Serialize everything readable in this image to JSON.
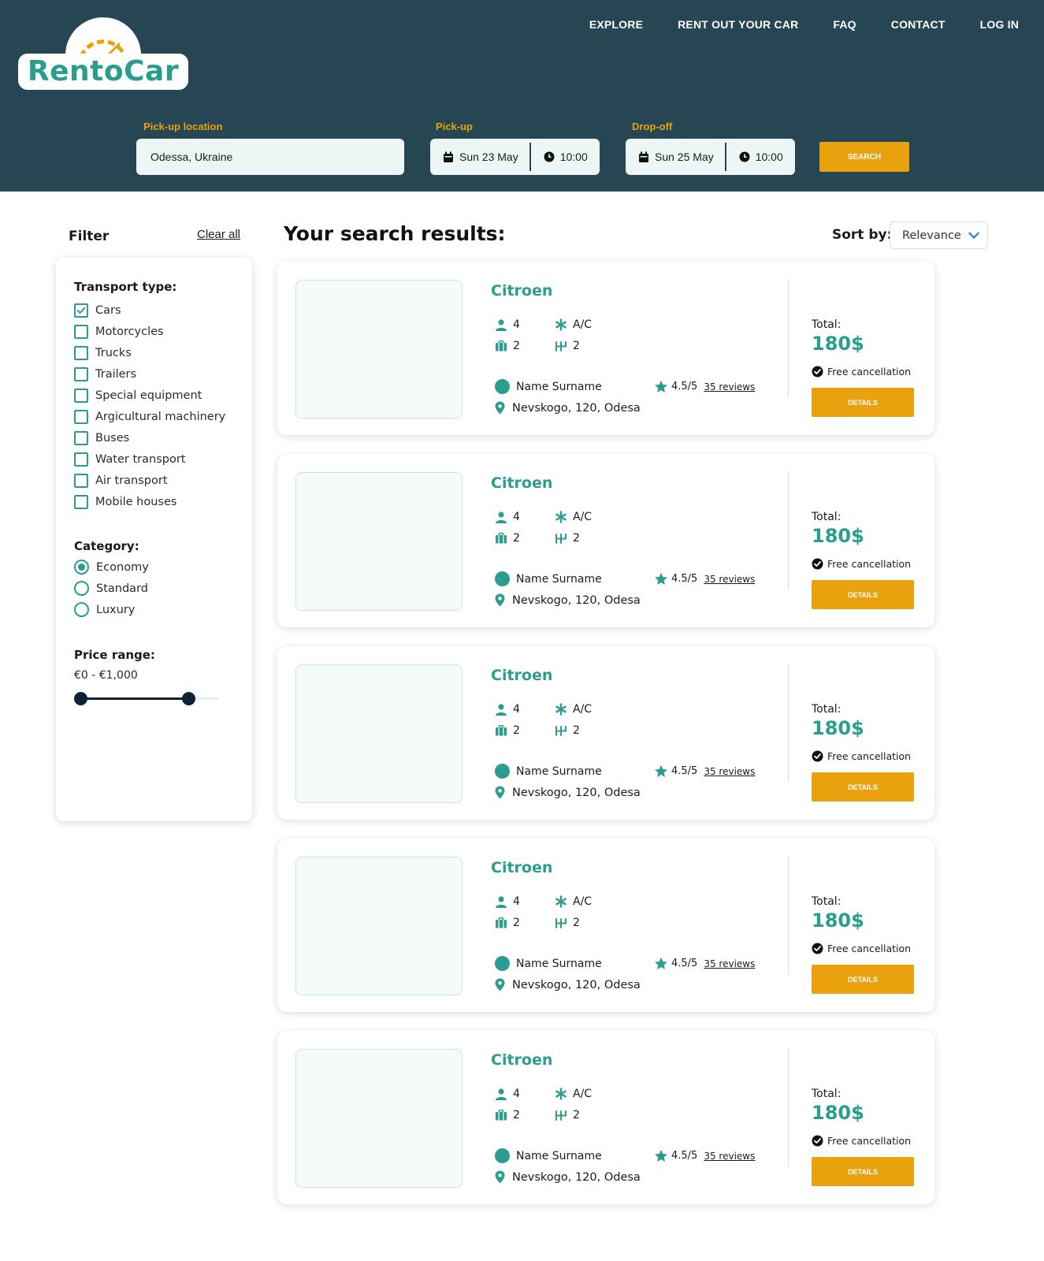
{
  "brand": {
    "name": "RentoCar"
  },
  "nav": [
    "EXPLORE",
    "RENT OUT YOUR CAR",
    "FAQ",
    "CONTACT",
    "LOG IN"
  ],
  "search": {
    "location_label": "Pick-up location",
    "location_value": "Odessa, Ukraine",
    "pickup_label": "Pick-up",
    "pickup_date": "Sun 23 May",
    "pickup_time": "10:00",
    "dropoff_label": "Drop-off",
    "dropoff_date": "Sun 25 May",
    "dropoff_time": "10:00",
    "button": "SEARCH"
  },
  "filter": {
    "title": "Filter",
    "clear": "Clear all",
    "transport_heading": "Transport type:",
    "transport_types": [
      {
        "label": "Cars",
        "checked": true
      },
      {
        "label": "Motorcycles",
        "checked": false
      },
      {
        "label": "Trucks",
        "checked": false
      },
      {
        "label": "Trailers",
        "checked": false
      },
      {
        "label": "Special equipment",
        "checked": false
      },
      {
        "label": "Argicultural machinery",
        "checked": false
      },
      {
        "label": "Buses",
        "checked": false
      },
      {
        "label": "Water transport",
        "checked": false
      },
      {
        "label": "Air transport",
        "checked": false
      },
      {
        "label": "Mobile houses",
        "checked": false
      }
    ],
    "category_heading": "Category:",
    "categories": [
      {
        "label": "Economy",
        "selected": true
      },
      {
        "label": "Standard",
        "selected": false
      },
      {
        "label": "Luxury",
        "selected": false
      }
    ],
    "price_heading": "Price range:",
    "price_text": "€0 - €1,000",
    "price_slider_fraction": {
      "low": 0.0,
      "high": 0.78
    }
  },
  "results": {
    "title": "Your search results:",
    "sort_label": "Sort by:",
    "sort_value": "Relevance",
    "items": [
      {
        "name": "Citroen",
        "seats": "4",
        "ac": "A/C",
        "bags": "2",
        "gears": "2",
        "owner": "Name Surname",
        "rating": "4.5/5",
        "reviews": "35 reviews",
        "address": "Nevskogo, 120, Odesa",
        "total_label": "Total:",
        "price": "180$",
        "cancel": "Free cancellation",
        "button": "DETAILS"
      },
      {
        "name": "Citroen",
        "seats": "4",
        "ac": "A/C",
        "bags": "2",
        "gears": "2",
        "owner": "Name Surname",
        "rating": "4.5/5",
        "reviews": "35 reviews",
        "address": "Nevskogo, 120, Odesa",
        "total_label": "Total:",
        "price": "180$",
        "cancel": "Free cancellation",
        "button": "DETAILS"
      },
      {
        "name": "Citroen",
        "seats": "4",
        "ac": "A/C",
        "bags": "2",
        "gears": "2",
        "owner": "Name Surname",
        "rating": "4.5/5",
        "reviews": "35 reviews",
        "address": "Nevskogo, 120, Odesa",
        "total_label": "Total:",
        "price": "180$",
        "cancel": "Free cancellation",
        "button": "DETAILS"
      },
      {
        "name": "Citroen",
        "seats": "4",
        "ac": "A/C",
        "bags": "2",
        "gears": "2",
        "owner": "Name Surname",
        "rating": "4.5/5",
        "reviews": "35 reviews",
        "address": "Nevskogo, 120, Odesa",
        "total_label": "Total:",
        "price": "180$",
        "cancel": "Free cancellation",
        "button": "DETAILS"
      },
      {
        "name": "Citroen",
        "seats": "4",
        "ac": "A/C",
        "bags": "2",
        "gears": "2",
        "owner": "Name Surname",
        "rating": "4.5/5",
        "reviews": "35 reviews",
        "address": "Nevskogo, 120, Odesa",
        "total_label": "Total:",
        "price": "180$",
        "cancel": "Free cancellation",
        "button": "DETAILS"
      }
    ]
  },
  "colors": {
    "header": "#264653",
    "accent": "#e9a20d",
    "teal": "#2a9d8f",
    "dark": "#0f2233"
  },
  "icons": [
    "calendar-icon",
    "clock-icon",
    "person-icon",
    "snowflake-icon",
    "luggage-icon",
    "gearbox-icon",
    "avatar",
    "star-icon",
    "location-pin-icon",
    "check-circle-icon",
    "chevron-down-icon",
    "checkbox-check-icon"
  ]
}
